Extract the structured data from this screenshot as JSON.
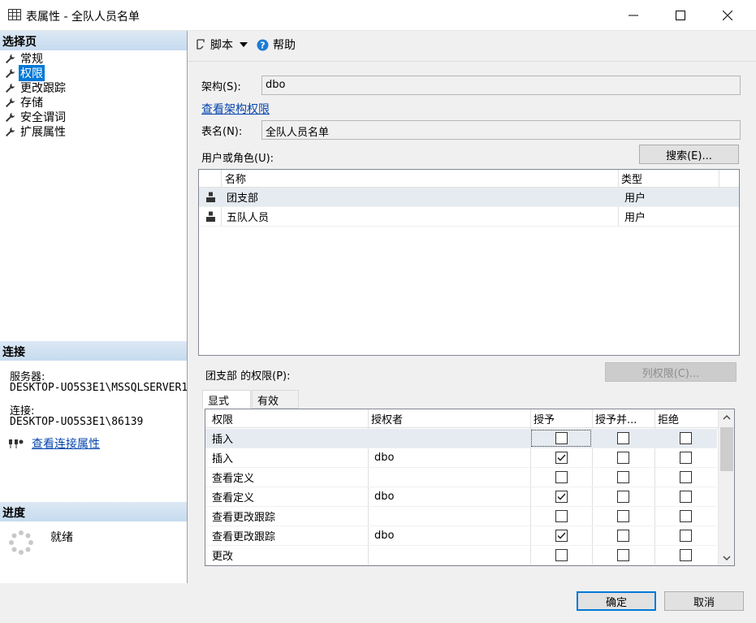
{
  "window": {
    "title": "表属性 - 全队人员名单"
  },
  "left": {
    "select_page_header": "选择页",
    "nav_items": [
      {
        "label": "常规",
        "selected": false
      },
      {
        "label": "权限",
        "selected": true
      },
      {
        "label": "更改跟踪",
        "selected": false
      },
      {
        "label": "存储",
        "selected": false
      },
      {
        "label": "安全谓词",
        "selected": false
      },
      {
        "label": "扩展属性",
        "selected": false
      }
    ],
    "connection_header": "连接",
    "server_label": "服务器:",
    "server_value": "DESKTOP-UO5S3E1\\MSSQLSERVER1",
    "conn_label": "连接:",
    "conn_value": "DESKTOP-UO5S3E1\\86139",
    "view_conn_props": "查看连接属性",
    "progress_header": "进度",
    "progress_status": "就绪"
  },
  "toolbar": {
    "script_label": "脚本",
    "help_label": "帮助"
  },
  "form": {
    "schema_label": "架构(S):",
    "schema_value": "dbo",
    "view_schema_perms": "查看架构权限",
    "table_label": "表名(N):",
    "table_value": "全队人员名单",
    "users_label": "用户或角色(U):",
    "search_button": "搜索(E)...",
    "users_columns": [
      "名称",
      "类型"
    ],
    "users": [
      {
        "name": "团支部",
        "type": "用户"
      },
      {
        "name": "五队人员",
        "type": "用户"
      }
    ],
    "perms_for_label": "团支部 的权限(P):",
    "column_perms_button": "列权限(C)...",
    "tabs": [
      "显式",
      "有效"
    ],
    "perm_columns": [
      "权限",
      "授权者",
      "授予",
      "授予并...",
      "拒绝"
    ],
    "perm_rows": [
      {
        "perm": "插入",
        "grantor": "",
        "grant": false,
        "with_grant": false,
        "deny": false
      },
      {
        "perm": "插入",
        "grantor": "dbo",
        "grant": true,
        "with_grant": false,
        "deny": false
      },
      {
        "perm": "查看定义",
        "grantor": "",
        "grant": false,
        "with_grant": false,
        "deny": false
      },
      {
        "perm": "查看定义",
        "grantor": "dbo",
        "grant": true,
        "with_grant": false,
        "deny": false
      },
      {
        "perm": "查看更改跟踪",
        "grantor": "",
        "grant": false,
        "with_grant": false,
        "deny": false
      },
      {
        "perm": "查看更改跟踪",
        "grantor": "dbo",
        "grant": true,
        "with_grant": false,
        "deny": false
      },
      {
        "perm": "更改",
        "grantor": "",
        "grant": false,
        "with_grant": false,
        "deny": false
      }
    ]
  },
  "footer": {
    "ok_button": "确定",
    "cancel_button": "取消"
  },
  "colors": {
    "selected_nav_bg": "#0078d7",
    "section_header_bg": "#c6dbef",
    "link": "#0645ad"
  }
}
